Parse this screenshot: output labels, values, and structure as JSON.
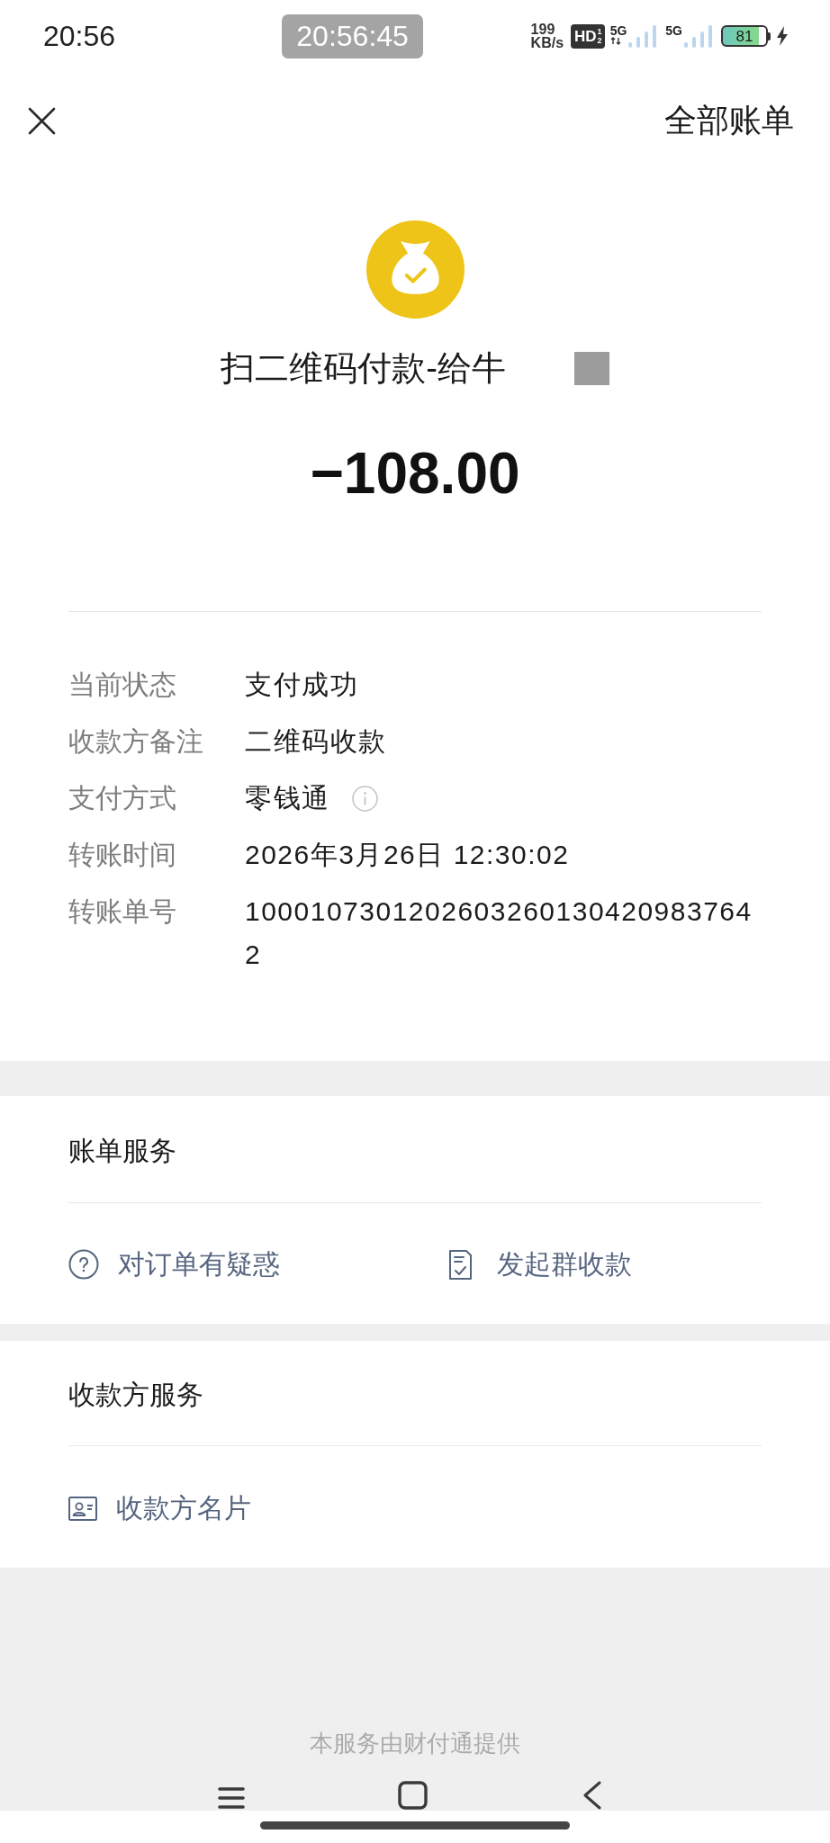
{
  "status_bar": {
    "time": "20:56",
    "clock_pill": "20:56:45",
    "net_speed": {
      "value": "199",
      "unit": "KB/s"
    },
    "hd_badge": {
      "label": "HD",
      "sup": "1",
      "sub": "2"
    },
    "signals": [
      {
        "label": "5G",
        "activity": true
      },
      {
        "label": "5G",
        "activity": false
      }
    ],
    "battery": {
      "label": "81",
      "charging": true
    }
  },
  "header": {
    "action": "全部账单"
  },
  "payment": {
    "title": "扫二维码付款-给牛",
    "title_redacted": true,
    "amount": "−108.00"
  },
  "details": [
    {
      "label": "当前状态",
      "value": "支付成功",
      "info": false
    },
    {
      "label": "收款方备注",
      "value": "二维码收款",
      "info": false
    },
    {
      "label": "支付方式",
      "value": "零钱通",
      "info": true
    },
    {
      "label": "转账时间",
      "value": "2026年3月26日 12:30:02",
      "info": false
    },
    {
      "label": "转账单号",
      "value": "10001073012026032601304209837642",
      "info": false
    }
  ],
  "sections": [
    {
      "title": "账单服务",
      "actions": [
        {
          "kind": "question",
          "label": "对订单有疑惑"
        },
        {
          "kind": "document",
          "label": "发起群收款"
        }
      ]
    },
    {
      "title": "收款方服务",
      "actions": [
        {
          "kind": "contact",
          "label": "收款方名片"
        }
      ]
    }
  ],
  "footer": "本服务由财付通提供"
}
